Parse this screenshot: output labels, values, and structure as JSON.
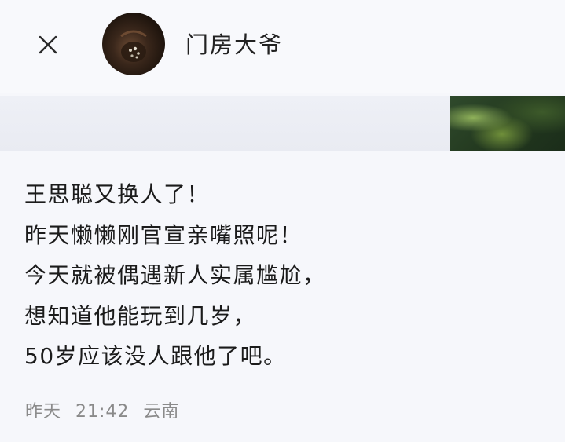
{
  "header": {
    "close_icon": "close-icon",
    "username": "门房大爷",
    "avatar": "avatar-image"
  },
  "post": {
    "lines": [
      "王思聪又换人了！",
      "昨天懒懒刚官宣亲嘴照呢！",
      "今天就被偶遇新人实属尴尬，",
      "想知道他能玩到几岁，",
      "50岁应该没人跟他了吧。"
    ]
  },
  "meta": {
    "day": "昨天",
    "time": "21:42",
    "location": "云南"
  },
  "colors": {
    "background": "#f6f7fb",
    "text": "#1b1b1b",
    "meta": "#8a8a8a"
  }
}
